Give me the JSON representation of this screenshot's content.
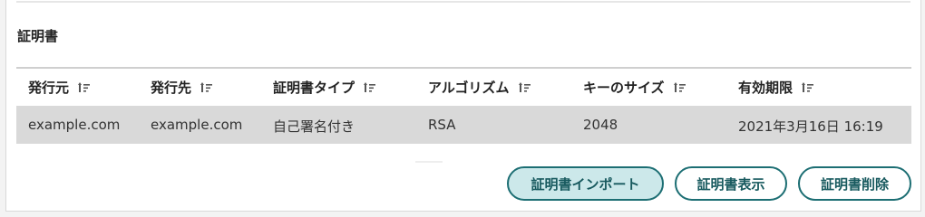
{
  "section": {
    "title": "証明書"
  },
  "table": {
    "columns": [
      {
        "label": "発行元",
        "icon": "sort-icon"
      },
      {
        "label": "発行先",
        "icon": "sort-icon"
      },
      {
        "label": "証明書タイプ",
        "icon": "sort-icon"
      },
      {
        "label": "アルゴリズム",
        "icon": "sort-icon"
      },
      {
        "label": "キーのサイズ",
        "icon": "sort-icon"
      },
      {
        "label": "有効期限",
        "icon": "sort-icon"
      }
    ],
    "rows": [
      {
        "issuer": "example.com",
        "subject": "example.com",
        "type": "自己署名付き",
        "algorithm": "RSA",
        "key_size": "2048",
        "expires": "2021年3月16日 16:19"
      }
    ]
  },
  "actions": {
    "import_label": "証明書インポート",
    "show_label": "証明書表示",
    "delete_label": "証明書削除"
  },
  "colors": {
    "accent": "#1c6e73",
    "selected_row": "#d9d9d9",
    "primary_button_bg": "#cce8ea"
  }
}
